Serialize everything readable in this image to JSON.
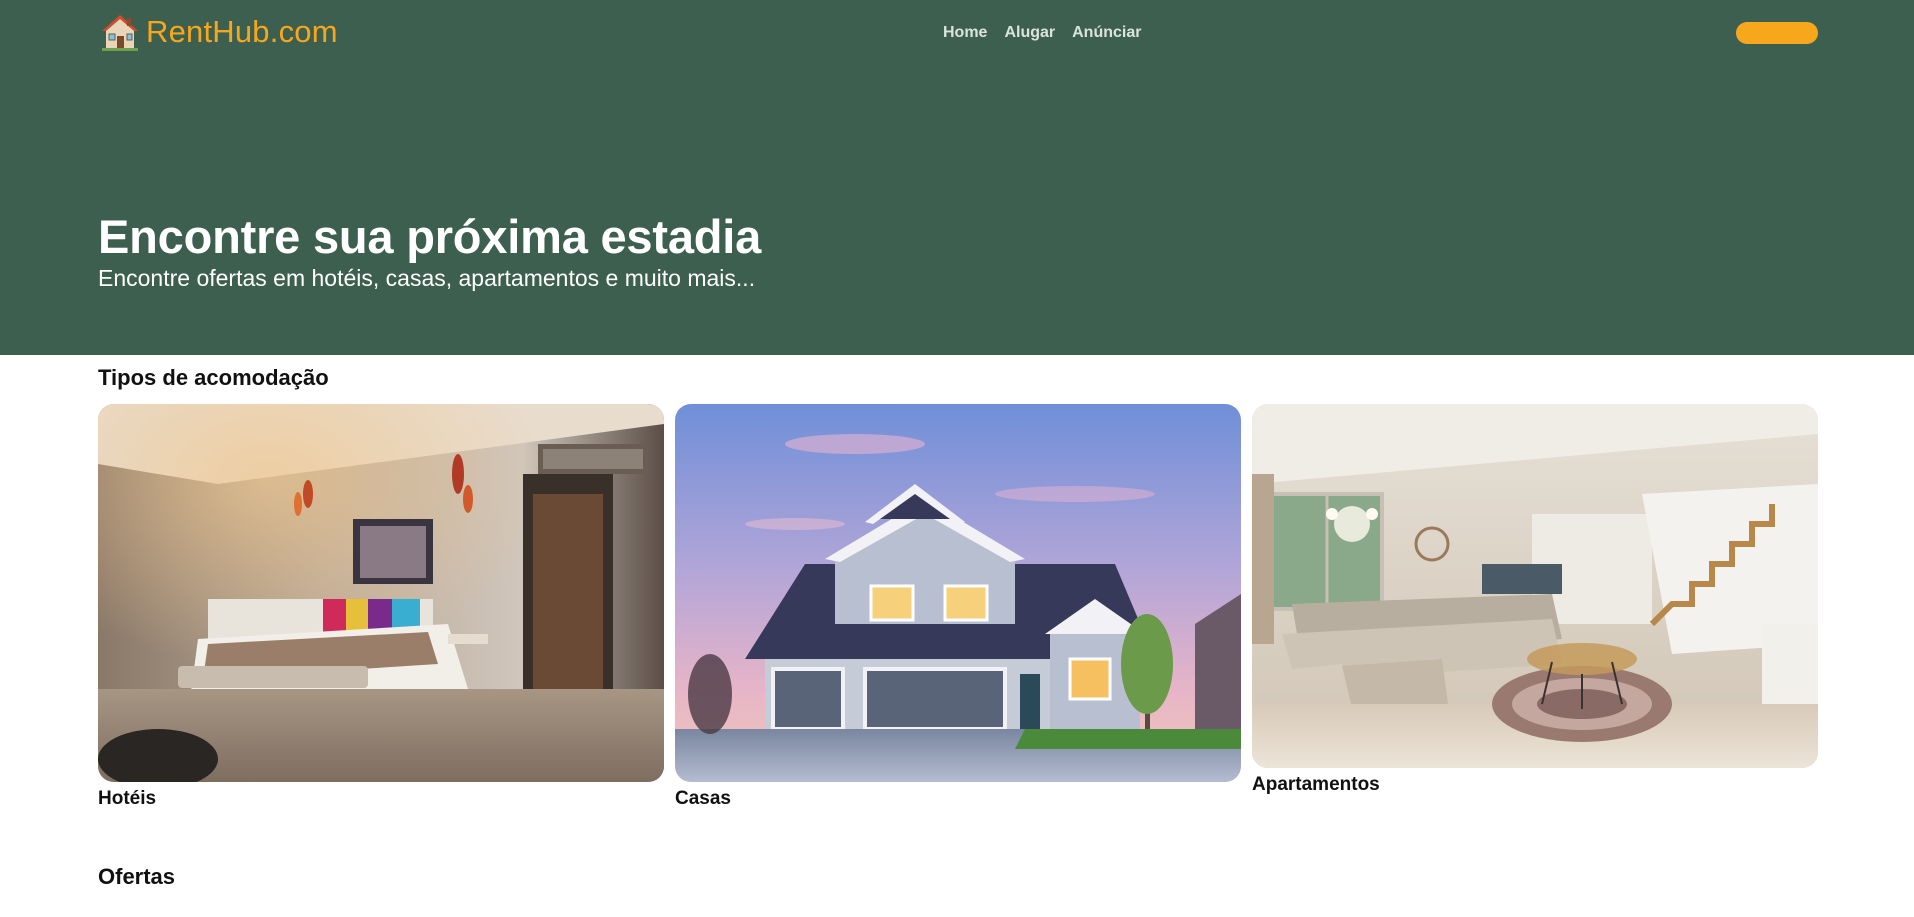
{
  "header": {
    "logo_icon": "house-emoji-icon",
    "logo_text": "RentHub.com",
    "nav": [
      {
        "label": "Home"
      },
      {
        "label": "Alugar"
      },
      {
        "label": "Anúnciar"
      }
    ],
    "cta_label": ""
  },
  "hero": {
    "title": "Encontre sua próxima estadia",
    "subtitle": "Encontre ofertas em hotéis, casas, apartamentos e muito mais..."
  },
  "accommodation": {
    "title": "Tipos de acomodação",
    "cards": [
      {
        "label": "Hotéis",
        "image": "hotel-room-photo"
      },
      {
        "label": "Casas",
        "image": "house-exterior-photo"
      },
      {
        "label": "Apartamentos",
        "image": "apartment-living-room-photo"
      }
    ]
  },
  "offers": {
    "title": "Ofertas"
  },
  "colors": {
    "hero_bg": "#3d5f50",
    "accent": "#f7a71b",
    "text_dark": "#111111",
    "nav_text": "#dbe3dd"
  }
}
